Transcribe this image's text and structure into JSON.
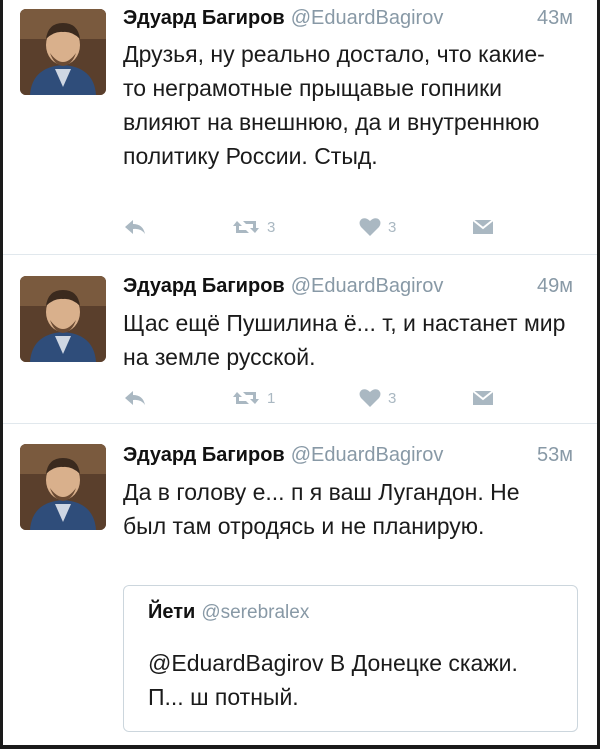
{
  "tweets": [
    {
      "author": {
        "name": "Эдуард Багиров",
        "handle": "@EduardBagirov"
      },
      "time": "43м",
      "text": "Друзья, ну реально достало, что какие-то неграмотные прыщавые гопники влияют на внешнюю, да и внутреннюю политику России. Стыд.",
      "retweets": "3",
      "likes": "3"
    },
    {
      "author": {
        "name": "Эдуард Багиров",
        "handle": "@EduardBagirov"
      },
      "time": "49м",
      "text": "Щас ещё Пушилина ё... т, и настанет мир на земле русской.",
      "retweets": "1",
      "likes": "3"
    },
    {
      "author": {
        "name": "Эдуард Багиров",
        "handle": "@EduardBagirov"
      },
      "time": "53м",
      "text": "Да в голову е... п я ваш Лугандон. Не был там отродясь и не планирую.",
      "quote": {
        "name": "Йети",
        "handle": "@serebralex",
        "text": "@EduardBagirov В Донецке скажи. П... ш потный."
      }
    }
  ],
  "icons": {
    "reply": "reply-icon",
    "retweet": "retweet-icon",
    "like": "heart-icon",
    "dm": "direct-message-icon"
  },
  "colors": {
    "action": "#aab8c2",
    "meta": "#8899a6",
    "text": "#1b1b1b"
  }
}
